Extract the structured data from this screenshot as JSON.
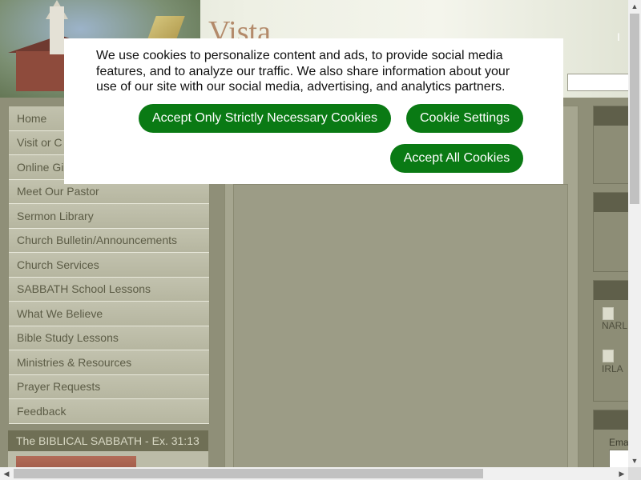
{
  "header": {
    "site_title": "Vista",
    "right_text": "I"
  },
  "nav": {
    "items": [
      {
        "label": "Home"
      },
      {
        "label": "Visit or C"
      },
      {
        "label": "Online Gi"
      },
      {
        "label": "Meet Our Pastor"
      },
      {
        "label": "Sermon Library"
      },
      {
        "label": "Church Bulletin/Announcements"
      },
      {
        "label": "Church Services"
      },
      {
        "label": "SABBATH School Lessons"
      },
      {
        "label": "What We Believe"
      },
      {
        "label": "Bible Study Lessons"
      },
      {
        "label": "Ministries & Resources"
      },
      {
        "label": "Prayer Requests"
      },
      {
        "label": "Feedback"
      }
    ]
  },
  "sabbath_box": {
    "title": "The BIBLICAL SABBATH - Ex. 31:13"
  },
  "right_sidebar": {
    "link1_label": "NARL",
    "link2_label": "IRLA",
    "email_label": "Ema"
  },
  "cookie_banner": {
    "text": "We use cookies to personalize content and ads, to provide social media features, and to analyze our traffic. We also share information about your use of our site with our social media, advertising, and analytics partners.",
    "btn_strict": "Accept Only Strictly Necessary Cookies",
    "btn_settings": "Cookie Settings",
    "btn_accept_all": "Accept All Cookies",
    "button_color": "#0a7a14"
  },
  "scrollbars": {
    "up_glyph": "▲",
    "down_glyph": "▼",
    "left_glyph": "◀",
    "right_glyph": "▶"
  }
}
